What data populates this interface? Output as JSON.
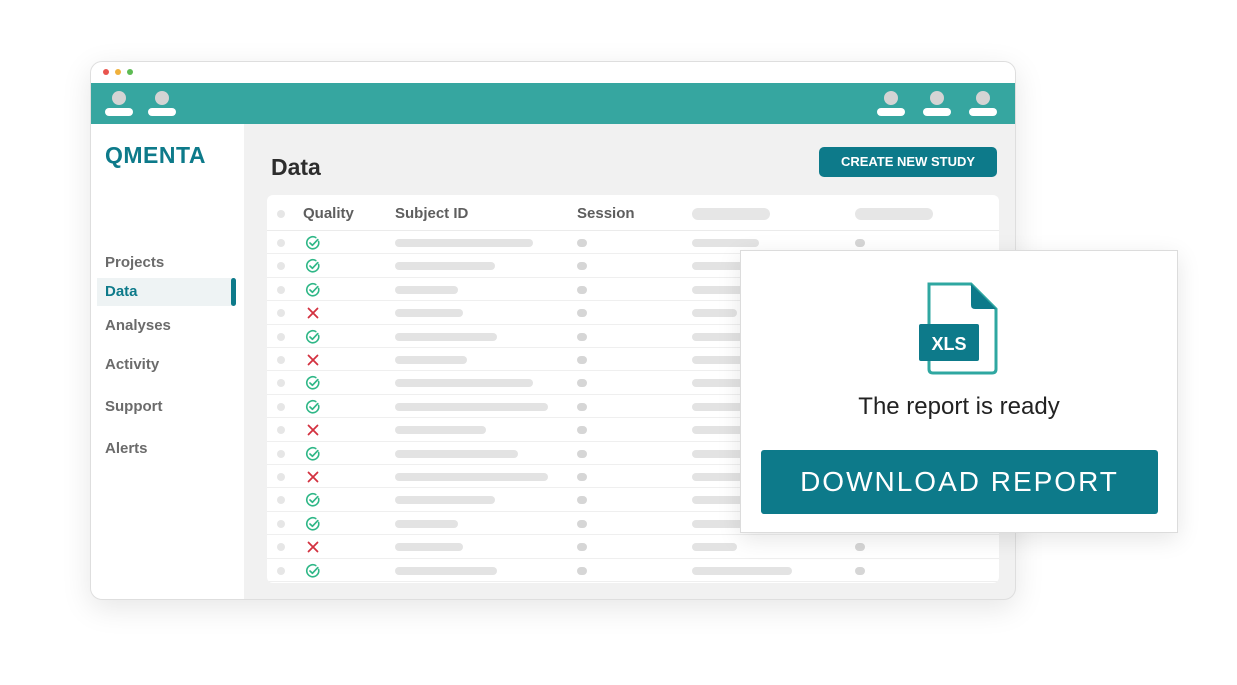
{
  "app": {
    "logo": "QMENTA"
  },
  "sidebar": {
    "items": [
      {
        "label": "Projects",
        "active": false
      },
      {
        "label": "Data",
        "active": true
      },
      {
        "label": "Analyses",
        "active": false
      },
      {
        "label": "Activity",
        "active": false
      },
      {
        "label": "Support",
        "active": false
      },
      {
        "label": "Alerts",
        "active": false
      }
    ]
  },
  "main": {
    "title": "Data",
    "create_button": "CREATE NEW STUDY",
    "table": {
      "headers": [
        "Quality",
        "Subject ID",
        "Session"
      ],
      "rows": [
        {
          "quality": "pass"
        },
        {
          "quality": "pass"
        },
        {
          "quality": "pass"
        },
        {
          "quality": "fail"
        },
        {
          "quality": "pass"
        },
        {
          "quality": "fail"
        },
        {
          "quality": "pass"
        },
        {
          "quality": "pass"
        },
        {
          "quality": "fail"
        },
        {
          "quality": "pass"
        },
        {
          "quality": "fail"
        },
        {
          "quality": "pass"
        },
        {
          "quality": "pass"
        },
        {
          "quality": "fail"
        },
        {
          "quality": "pass"
        }
      ]
    }
  },
  "popup": {
    "file_type": "XLS",
    "message": "The report is ready",
    "download_button": "DOWNLOAD REPORT"
  },
  "colors": {
    "accent": "#0d7a8a",
    "topbar": "#36a6a0",
    "pass": "#2fb787",
    "fail": "#d3313f"
  },
  "icons": {
    "pass": "check-circle-icon",
    "fail": "x-mark-icon",
    "file": "xls-file-icon"
  }
}
